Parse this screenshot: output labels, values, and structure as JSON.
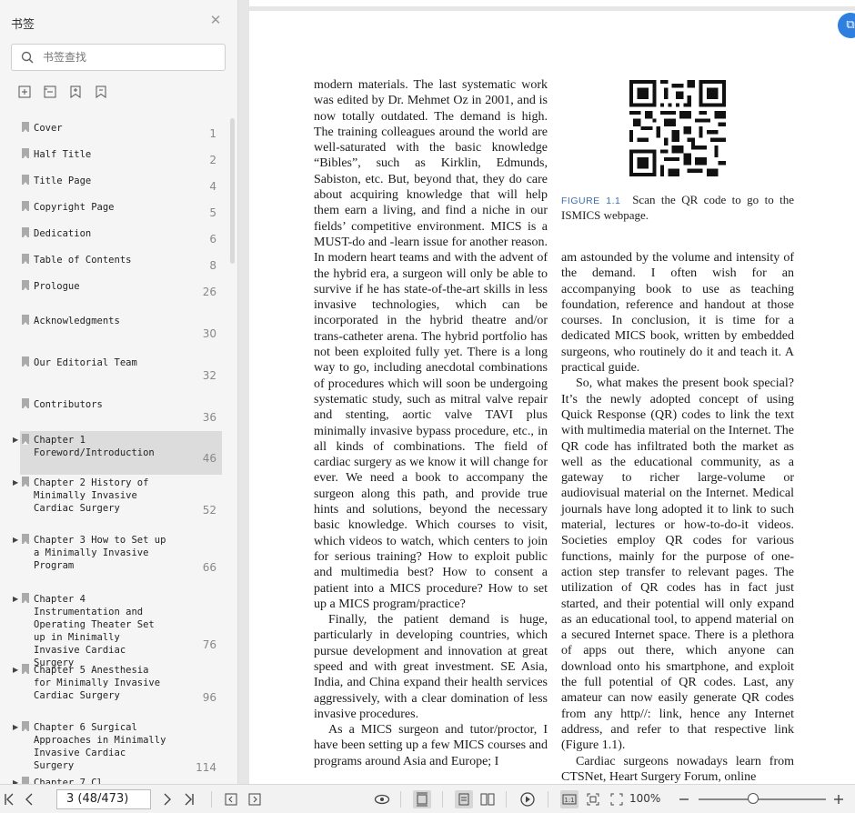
{
  "sidebar": {
    "title": "书签",
    "search_placeholder": "书签查找",
    "bookmarks": [
      {
        "title": "Cover",
        "page": "1",
        "expandable": false
      },
      {
        "title": "Half Title",
        "page": "2",
        "expandable": false
      },
      {
        "title": "Title Page",
        "page": "4",
        "expandable": false
      },
      {
        "title": "Copyright Page",
        "page": "5",
        "expandable": false
      },
      {
        "title": "Dedication",
        "page": "6",
        "expandable": false
      },
      {
        "title": "Table of Contents",
        "page": "8",
        "expandable": false
      },
      {
        "title": "Prologue",
        "page": "26",
        "expandable": false
      },
      {
        "title": "Acknowledgments",
        "page": "30",
        "expandable": false
      },
      {
        "title": "Our Editorial Team",
        "page": "32",
        "expandable": false
      },
      {
        "title": "Contributors",
        "page": "36",
        "expandable": false
      },
      {
        "title": "Chapter 1 Foreword/Introduction",
        "page": "46",
        "expandable": true,
        "selected": true
      },
      {
        "title": "Chapter 2 History of Minimally Invasive Cardiac Surgery",
        "page": "52",
        "expandable": true
      },
      {
        "title": "Chapter 3 How to Set up a Minimally Invasive Program",
        "page": "66",
        "expandable": true
      },
      {
        "title": "Chapter 4 Instrumentation and Operating Theater Set up in Minimally  Invasive Cardiac Surgery",
        "page": "76",
        "expandable": true
      },
      {
        "title": "Chapter 5 Anesthesia for Minimally Invasive Cardiac Surgery",
        "page": "96",
        "expandable": true
      },
      {
        "title": "Chapter 6 Surgical Approaches in Minimally Invasive Cardiac Surgery",
        "page": "114",
        "expandable": true
      },
      {
        "title": "Chapter 7 Cl...",
        "page": "",
        "expandable": true
      }
    ]
  },
  "document": {
    "column1": [
      "modern materials. The last systematic work was edited by Dr. Mehmet Oz in 2001, and is now totally outdated. The demand is high. The training colleagues around the world are well-saturated with the basic knowledge “Bibles”, such as Kirklin, Edmunds, Sabiston, etc. But, beyond that, they do care about acquiring knowledge that will help them earn a living, and find a niche in our fields’ competitive environment. MICS is a MUST-do and -learn issue for another reason. In modern heart teams and with the advent of the hybrid era, a surgeon will only be able to survive if he has state-of-the-art skills in less invasive technologies, which can be incorporated in the hybrid theatre and/or trans-catheter arena. The hybrid portfolio has not been exploited fully yet. There is a long way to go, including anecdotal combinations of procedures which will soon be undergoing systematic study, such as mitral valve repair and stenting, aortic valve TAVI plus minimally invasive bypass procedure, etc., in all kinds of combinations. The field of cardiac surgery as we know it will change for ever. We need a book to accompany the surgeon along this path, and provide true hints and solutions, beyond the necessary basic knowledge. Which courses to visit, which videos to watch, which centers to join for serious training? How to exploit public and multimedia best? How to consent a patient into a MICS procedure? How to set up a MICS program/practice?",
      "Finally, the patient demand is huge, particularly in developing countries, which pursue development and innovation at great speed and with great investment. SE Asia, India, and China expand their health services aggressively, with a clear domination of less invasive procedures.",
      "As a MICS surgeon and tutor/proctor, I have been setting up a few MICS courses and programs around Asia and Europe; I"
    ],
    "figure_label": "FIGURE 1.1",
    "figure_caption": "Scan the QR code to go to the ISMICS webpage.",
    "column2": [
      "am astounded by the volume and intensity of the demand. I often wish for an accompanying book to use as teaching foundation, reference and handout at those courses. In conclusion, it is time for a dedicated MICS book, written by embedded surgeons, who routinely do it and teach it. A practical guide.",
      "So, what makes the present book special? It’s the newly adopted concept of using Quick Response (QR) codes to link the text with multimedia material on the Internet. The QR code has infiltrated both the market as well as the educational community, as a gateway to richer large-volume or audiovisual material on the Internet. Medical journals have long adopted it to link to such material, lectures or how-to-do-it videos. Societies employ QR codes for various functions, mainly for the purpose of one-action step transfer to relevant pages. The utilization of QR codes has in fact just started, and their potential will only expand as an educational tool, to append material on a secured Internet space. There is a plethora of apps out there, which anyone can download onto his smartphone, and exploit the full potential of QR codes. Last, any amateur can now easily generate QR codes from any http//: link, hence any Internet address, and refer to that respective link (Figure 1.1).",
      "Cardiac surgeons nowadays learn from CTSNet, Heart Surgery Forum, online"
    ]
  },
  "toolbar": {
    "page_value": "3 (48/473)",
    "zoom": "100%",
    "zoom_fraction": 0.43
  },
  "colors": {
    "accent": "#2f7fe0",
    "caption_label": "#3f6fb0"
  }
}
